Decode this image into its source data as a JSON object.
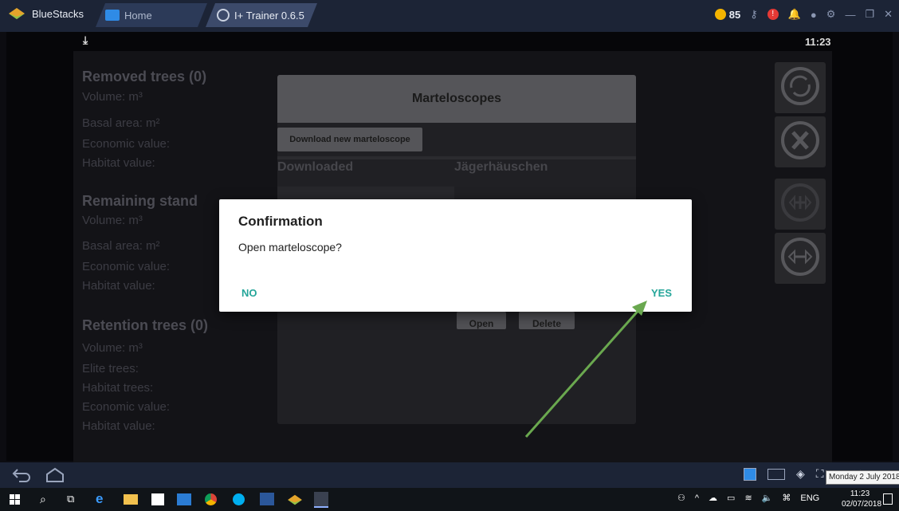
{
  "titlebar": {
    "app_name": "BlueStacks",
    "tabs": [
      {
        "label": "Home"
      },
      {
        "label": "I+ Trainer 0.6.5"
      }
    ],
    "coins": "85"
  },
  "statusbar": {
    "time": "11:23"
  },
  "stats": {
    "removed_title": "Removed trees (0)",
    "removed_lines": [
      "Volume: m³",
      "Basal area: m²",
      "Economic value:",
      "Habitat value:"
    ],
    "remaining_title": "Remaining stand",
    "remaining_lines": [
      "Volume: m³",
      "Basal area: m²",
      "Economic value:",
      "Habitat value:"
    ],
    "retention_title": "Retention trees (0)",
    "retention_lines": [
      "Volume: m³",
      "Elite trees:",
      "Habitat trees:",
      "Economic value:",
      "Habitat value:"
    ]
  },
  "marteloscopes": {
    "title": "Marteloscopes",
    "download_button": "Download new marteloscope",
    "downloaded_label": "Downloaded",
    "selected_name": "Jägerhäuschen",
    "open_button": "Open",
    "delete_button": "Delete"
  },
  "dialog": {
    "title": "Confirmation",
    "message": "Open marteloscope?",
    "no_label": "NO",
    "yes_label": "YES"
  },
  "tray": {
    "tooltip": "Monday 2 July 2018",
    "time": "11:23",
    "date": "02/07/2018",
    "language": "ENG"
  },
  "colors": {
    "dialog_accent": "#26a69a",
    "arrow": "#6aa84f"
  }
}
